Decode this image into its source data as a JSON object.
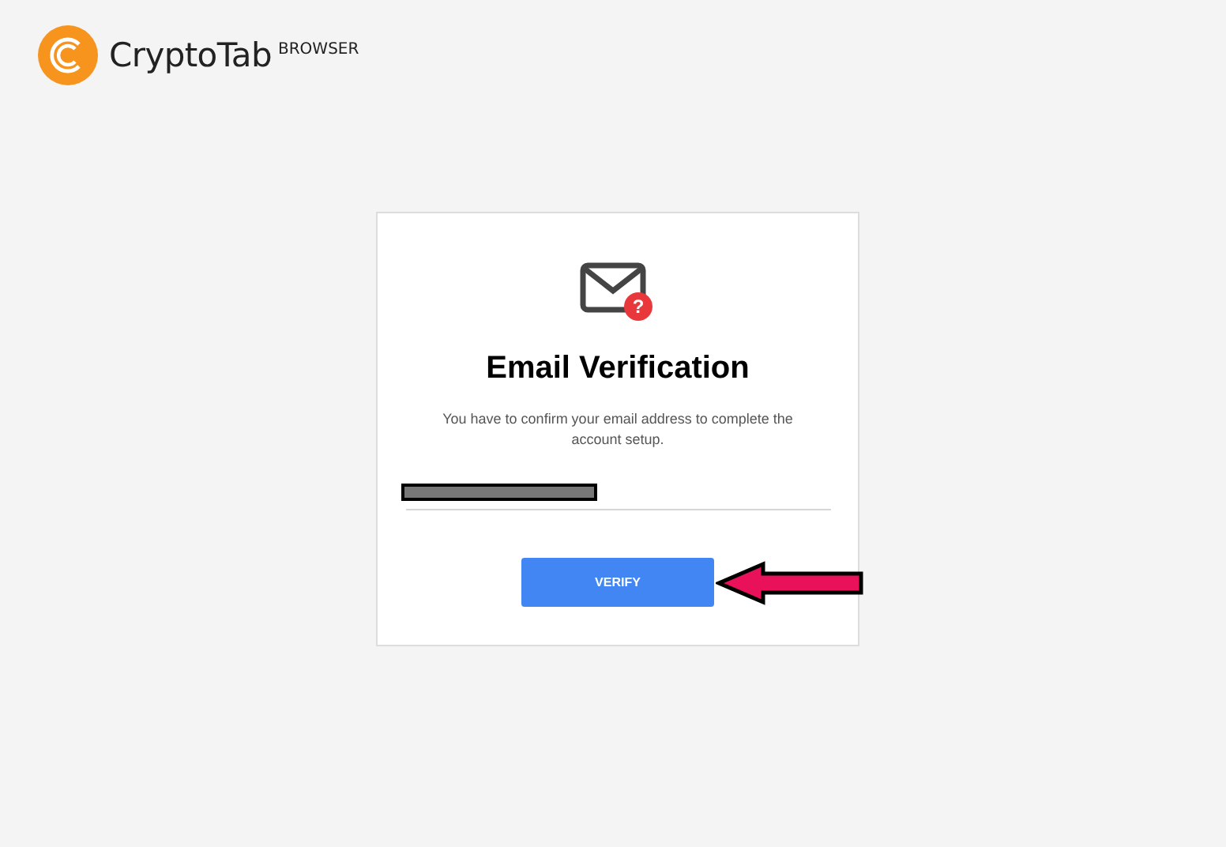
{
  "brand": {
    "name": "CryptoTab",
    "suffix": "BROWSER"
  },
  "card": {
    "badge": "?",
    "title": "Email Verification",
    "message": "You have to confirm your email address to complete the account setup.",
    "button": "VERIFY"
  }
}
